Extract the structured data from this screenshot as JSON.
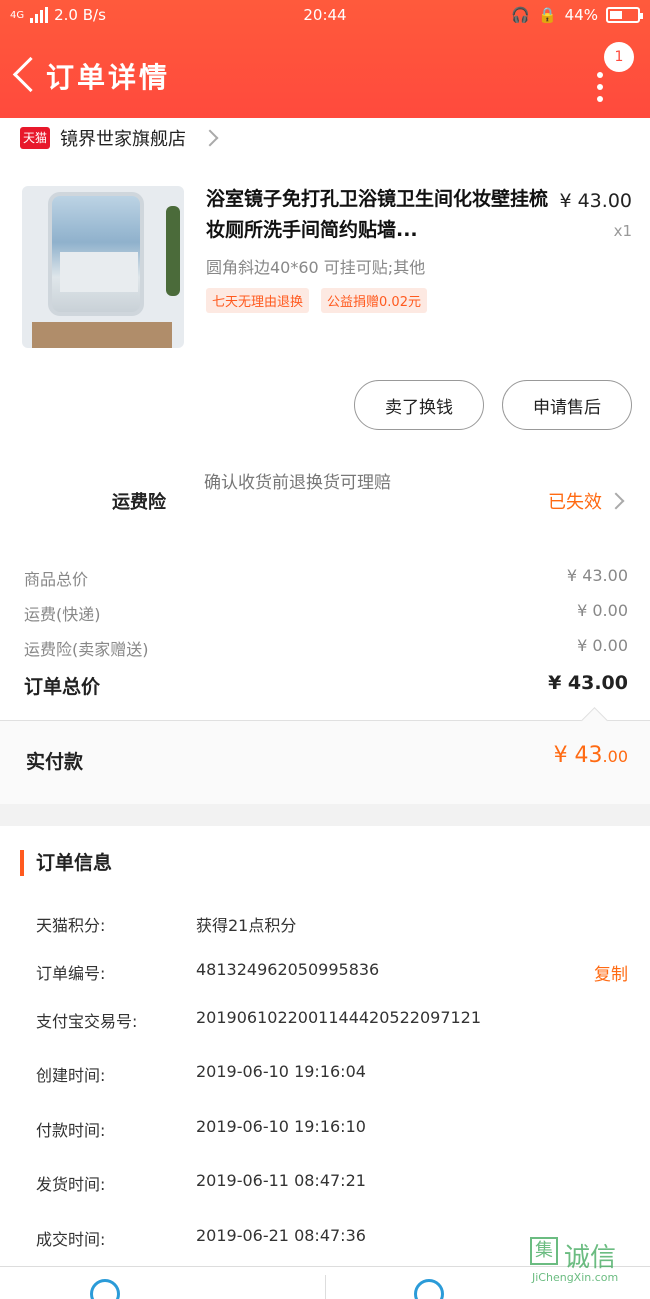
{
  "status_bar": {
    "network": "4G",
    "speed": "2.0 B/s",
    "time": "20:44",
    "battery": "44%"
  },
  "header": {
    "title": "订单详情",
    "badge_count": "1"
  },
  "store": {
    "platform_label": "天猫",
    "name": "镜界世家旗舰店"
  },
  "product": {
    "name": "浴室镜子免打孔卫浴镜卫生间化妆壁挂梳妆厕所洗手间简约贴墙...",
    "price": "¥ 43.00",
    "quantity": "x1",
    "sku": "圆角斜边40*60 可挂可贴;其他",
    "tags": [
      "七天无理由退换",
      "公益捐赠0.02元"
    ]
  },
  "actions": {
    "buy_again": "卖了换钱",
    "after_sales": "申请售后"
  },
  "insurance": {
    "label": "运费险",
    "description": "确认收货前退换货可理赔",
    "status": "已失效"
  },
  "summary": {
    "rows": [
      {
        "label": "商品总价",
        "value": "¥ 43.00"
      },
      {
        "label": "运费(快递)",
        "value": "¥ 0.00"
      },
      {
        "label": "运费险(卖家赠送)",
        "value": "¥ 0.00"
      }
    ],
    "total_label": "订单总价",
    "total_value": "¥ 43.00"
  },
  "paid": {
    "label": "实付款",
    "amount_int": "¥ 43",
    "amount_dec": ".00"
  },
  "order_info": {
    "heading": "订单信息",
    "rows": [
      {
        "key": "天猫积分:",
        "value": "获得21点积分"
      },
      {
        "key": "订单编号:",
        "value": "481324962050995836"
      },
      {
        "key": "支付宝交易号:",
        "value": "2019061022001144420522097121"
      },
      {
        "key": "创建时间:",
        "value": "2019-06-10 19:16:04"
      },
      {
        "key": "付款时间:",
        "value": "2019-06-10 19:16:10"
      },
      {
        "key": "发货时间:",
        "value": "2019-06-11 08:47:21"
      },
      {
        "key": "成交时间:",
        "value": "2019-06-21 08:47:36"
      }
    ],
    "copy_label": "复制"
  },
  "watermark": {
    "box_char": "集",
    "text": "诚信",
    "url": "JiChengXin.com"
  },
  "colors": {
    "header": "#ff4a3d",
    "accent": "#ff6a12",
    "tmall": "#e8182b"
  }
}
